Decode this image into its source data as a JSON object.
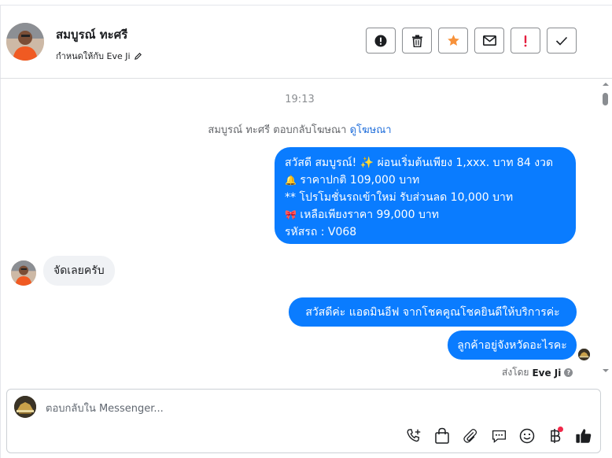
{
  "header": {
    "contact_name": "สมบูรณ์ ทะศรี",
    "assigned_label": "กำหนดให้กับ Eve Ji",
    "action_icons": [
      "spam-icon",
      "trash-icon",
      "star-icon",
      "envelope-icon",
      "follow-up-icon",
      "done-icon"
    ],
    "star_color": "#f7923b",
    "follow_up_color": "#e41e3f"
  },
  "conversation": {
    "timestamp": "19:13",
    "ad_reply_text": "สมบูรณ์ ทะศรี ตอบกลับโฆษณา",
    "ad_link": "ดูโฆษณา",
    "ad_message": {
      "line1": "สวัสดี สมบูรณ์! ✨  ผ่อนเริ่มต้นเพียง 1,xxx. บาท 84 งวด",
      "line2_icon": "🔔",
      "line2": " ราคาปกติ 109,000 บาท",
      "line3": "** โปรโมชั่นรถเข้าใหม่ รับส่วนลด 10,000 บาท",
      "line4_icon": "🎀",
      "line4": "  เหลือเพียงราคา 99,000 บาท",
      "line5": " รหัสรถ : V068"
    },
    "customer_reply": "จัดเลยครับ",
    "agent_messages": [
      "สวัสดีค่ะ แอดมินอีฟ จากโชคคูณโชคยินดีให้บริการค่ะ",
      "ลูกค้าอยู่จังหวัดอะไรคะ"
    ],
    "sent_by_prefix": "ส่งโดย",
    "sent_by_name": "Eve Ji",
    "help_glyph": "?"
  },
  "composer": {
    "placeholder": "ตอบกลับใน Messenger...",
    "tool_icons": [
      "call-add-icon",
      "shopping-bag-icon",
      "paperclip-icon",
      "saved-reply-icon",
      "emoji-icon",
      "baht-payment-icon",
      "thumbs-up-icon"
    ],
    "accent": "#0a7cff"
  }
}
